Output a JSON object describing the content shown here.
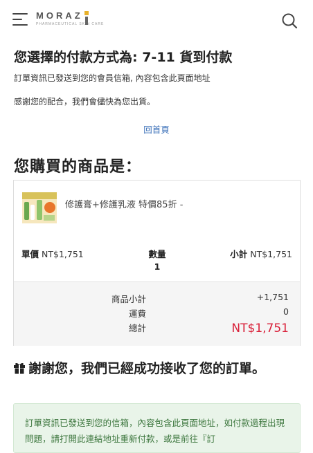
{
  "header": {
    "logo_text": "MORAZ",
    "logo_tagline": "PHARMACEUTICAL SKIN CARE",
    "menu_icon": "hamburger-menu-icon",
    "search_icon": "search-icon"
  },
  "payment": {
    "title": "您選擇的付款方式為: 7-11 貨到付款",
    "info_line1": "訂單資訊已發送到您的會員信箱, 內容包含此頁面地址",
    "info_line2": "感謝您的配合，我們會儘快為您出貨。",
    "home_link": "回首頁"
  },
  "purchase": {
    "title": "您購買的商品是：",
    "item": {
      "thumbnail_icon": "product-thumbnail",
      "name": "修護膏+修護乳液 特價85折 -",
      "unit_price_label": "單價",
      "unit_price": "NT$1,751",
      "qty_label": "數量",
      "qty": "1",
      "subtotal_label": "小計",
      "subtotal": "NT$1,751"
    },
    "summary": {
      "items_subtotal_label": "商品小計",
      "items_subtotal": "+1,751",
      "shipping_label": "運費",
      "shipping": "0",
      "total_label": "總計",
      "total": "NT$1,751"
    }
  },
  "thanks": {
    "icon": "gift-icon",
    "message": "謝謝您，我們已經成功接收了您的訂單。"
  },
  "notice": {
    "text": "訂單資訊已發送到您的信箱，內容包含此頁面地址，如付款過程出現問題，請打開此連結地址重新付款，或是前往『訂"
  },
  "colors": {
    "link": "#3a6fb8",
    "total": "#d9213a",
    "notice_bg": "#e9f4e9",
    "notice_text": "#3c763d",
    "logo_accent": "#e8b12a"
  }
}
